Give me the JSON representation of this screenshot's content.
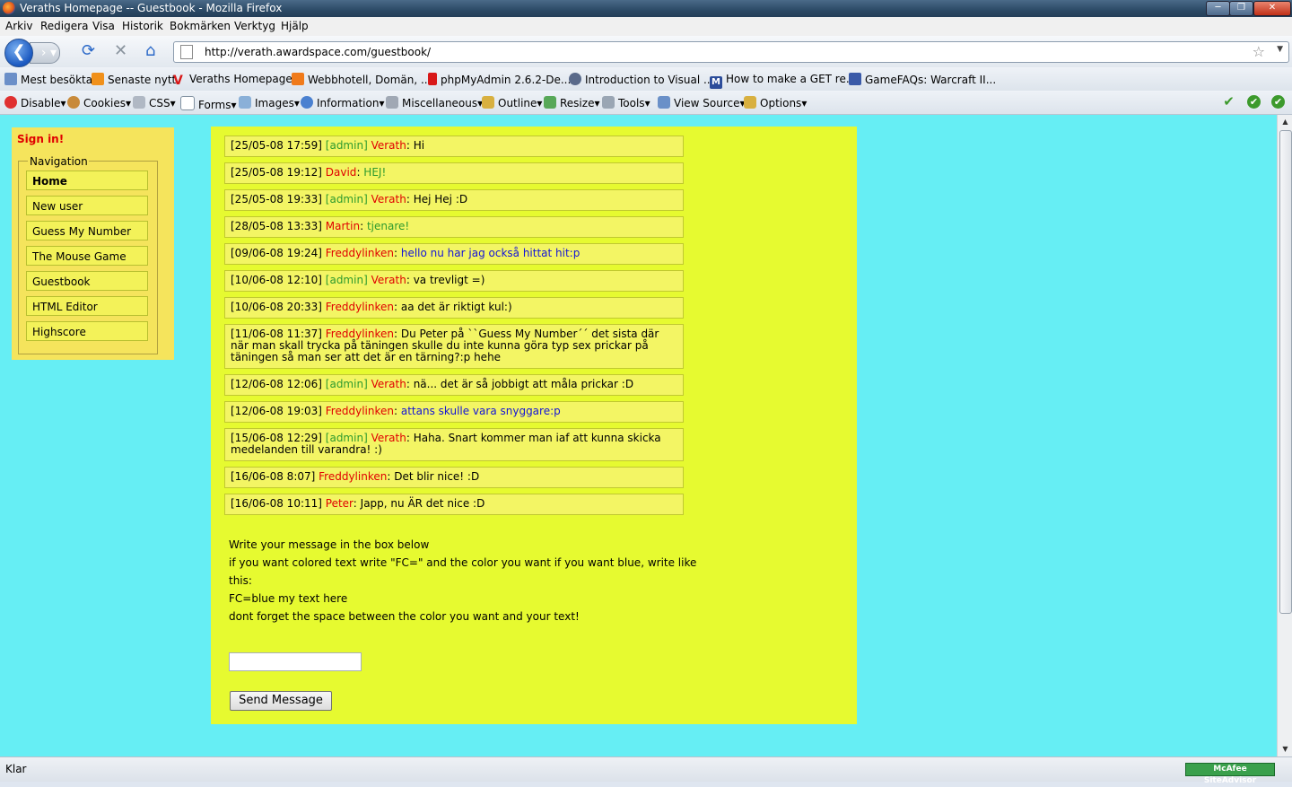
{
  "window": {
    "title": "Veraths Homepage -- Guestbook - Mozilla Firefox"
  },
  "menu": [
    "Arkiv",
    "Redigera",
    "Visa",
    "Historik",
    "Bokmärken",
    "Verktyg",
    "Hjälp"
  ],
  "address": {
    "url": "http://verath.awardspace.com/guestbook/"
  },
  "bookmarks": [
    "Mest besökta",
    "Senaste nytt",
    "Veraths Homepage",
    "Webbhotell, Domän, ...",
    "phpMyAdmin 2.6.2-De...",
    "Introduction to Visual ...",
    "How to make a GET re...",
    "GameFAQs: Warcraft II..."
  ],
  "devtoolbar": [
    "Disable",
    "Cookies",
    "CSS",
    "Forms",
    "Images",
    "Information",
    "Miscellaneous",
    "Outline",
    "Resize",
    "Tools",
    "View Source",
    "Options"
  ],
  "sidebar": {
    "signin": "Sign in!",
    "legend": "Navigation",
    "items": [
      "Home",
      "New user",
      "Guess My Number",
      "The Mouse Game",
      "Guestbook",
      "HTML Editor",
      "Highscore"
    ]
  },
  "messages": [
    {
      "ts": "[25/05-08 17:59]",
      "admin": "[admin]",
      "name": "Verath",
      "text": "Hi",
      "color": "black"
    },
    {
      "ts": "[25/05-08 19:12]",
      "admin": "",
      "name": "David",
      "text": "HEJ!",
      "color": "green"
    },
    {
      "ts": "[25/05-08 19:33]",
      "admin": "[admin]",
      "name": "Verath",
      "text": "Hej Hej :D",
      "color": "black"
    },
    {
      "ts": "[28/05-08 13:33]",
      "admin": "",
      "name": "Martin",
      "text": "tjenare!",
      "color": "green"
    },
    {
      "ts": "[09/06-08 19:24]",
      "admin": "",
      "name": "Freddylinken",
      "text": "hello nu har jag också hittat hit:p",
      "color": "blue"
    },
    {
      "ts": "[10/06-08 12:10]",
      "admin": "[admin]",
      "name": "Verath",
      "text": "va trevligt =)",
      "color": "black"
    },
    {
      "ts": "[10/06-08 20:33]",
      "admin": "",
      "name": "Freddylinken",
      "text": "aa det är riktigt kul:)",
      "color": "black"
    },
    {
      "ts": "[11/06-08 11:37]",
      "admin": "",
      "name": "Freddylinken",
      "text": "Du Peter på ``Guess My Number´´ det sista där när man skall trycka på täningen skulle du inte kunna göra typ sex prickar på täningen så man ser att det är en tärning?:p hehe",
      "color": "black"
    },
    {
      "ts": "[12/06-08 12:06]",
      "admin": "[admin]",
      "name": "Verath",
      "text": "nä... det är så jobbigt att måla prickar :D",
      "color": "black"
    },
    {
      "ts": "[12/06-08 19:03]",
      "admin": "",
      "name": "Freddylinken",
      "text": "attans skulle vara snyggare:p",
      "color": "blue"
    },
    {
      "ts": "[15/06-08 12:29]",
      "admin": "[admin]",
      "name": "Verath",
      "text": "Haha. Snart kommer man iaf att kunna skicka medelanden till varandra! :)",
      "color": "black"
    },
    {
      "ts": "[16/06-08 8:07]",
      "admin": "",
      "name": "Freddylinken",
      "text": "Det blir nice! :D",
      "color": "black"
    },
    {
      "ts": "[16/06-08 10:11]",
      "admin": "",
      "name": "Peter",
      "text": "Japp, nu ÄR det nice :D",
      "color": "black"
    }
  ],
  "instructions": {
    "line1": "Write your message in the box below",
    "line2": "if you want colored text write \"FC=\" and the color you want if you want blue, write like",
    "line3": "this:",
    "example": "FC=blue my text here",
    "line4": "dont forget the space between the color you want and your text!"
  },
  "form": {
    "message_value": "",
    "send_label": "Send Message"
  },
  "status": {
    "text": "Klar",
    "addon": "McAfee SiteAdvisor"
  },
  "colors": {
    "page_bg": "#66eef4",
    "panel_bg": "#e6fa30",
    "sidebar_bg": "#f5e45c",
    "name_red": "#e00000",
    "admin_green": "#2e9a2e",
    "link_blue": "#1414d8"
  }
}
